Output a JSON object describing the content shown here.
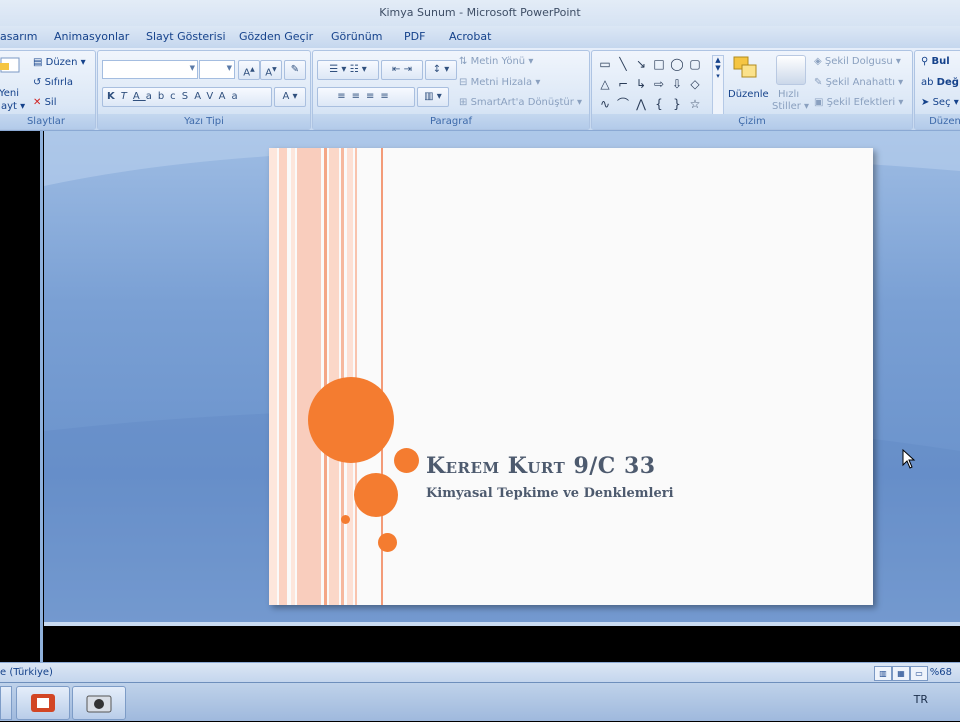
{
  "window": {
    "title": "Kimya Sunum - Microsoft PowerPoint"
  },
  "tabs": [
    "asarım",
    "Animasyonlar",
    "Slayt Gösterisi",
    "Gözden Geçir",
    "Görünüm",
    "PDF",
    "Acrobat"
  ],
  "ribbon": {
    "slaytlar": {
      "label": "Slaytlar",
      "yeni_line1": "Yeni",
      "yeni_line2": "ayt",
      "duzen": "Düzen",
      "sifirla": "Sıfırla",
      "sil": "Sil"
    },
    "yazi_tipi": {
      "label": "Yazı Tipi",
      "font_value": "",
      "size_value": ""
    },
    "paragraf": {
      "label": "Paragraf",
      "metin_yonu": "Metin Yönü",
      "metni_hizala": "Metni Hizala",
      "smartart": "SmartArt'a Dönüştür"
    },
    "cizim": {
      "label": "Çizim",
      "duzenle": "Düzenle",
      "hizli_line1": "Hızlı",
      "hizli_line2": "Stiller",
      "sekil_dolgusu": "Şekil Dolgusu",
      "sekil_anahatti": "Şekil Anahattı",
      "sekil_efektleri": "Şekil Efektleri"
    },
    "duzenleme": {
      "label": "Düzen",
      "bul": "Bul",
      "degistir": "Değ",
      "sec": "Seç"
    }
  },
  "slide": {
    "title": "Kerem Kurt 9/C 33",
    "subtitle": "Kimyasal Tepkime ve Denklemleri",
    "accent": "#f47c30"
  },
  "status": {
    "language": "e (Türkiye)",
    "zoom": "%68"
  },
  "taskbar": {
    "tray_lang": "TR"
  }
}
